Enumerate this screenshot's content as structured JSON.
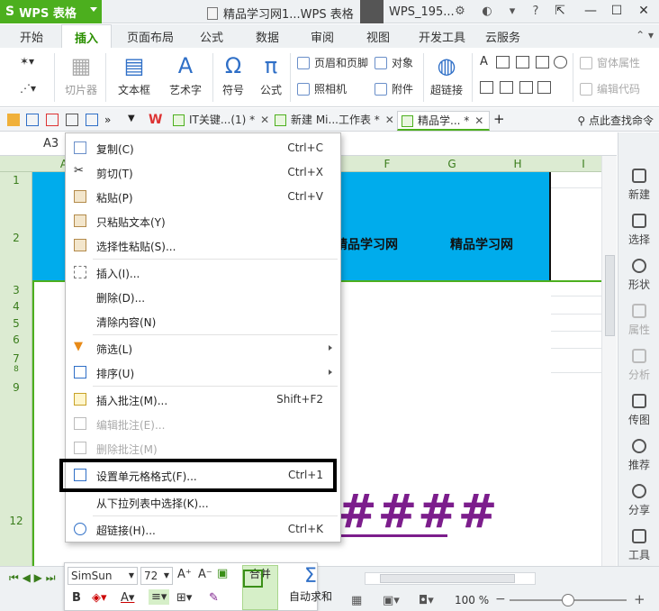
{
  "app": {
    "name": "WPS 表格",
    "logo": "S"
  },
  "title": {
    "doc": "精品学习网1...WPS 表格",
    "user": "WPS_195..."
  },
  "menu_tabs": [
    "开始",
    "插入",
    "页面布局",
    "公式",
    "数据",
    "审阅",
    "视图",
    "开发工具",
    "云服务"
  ],
  "ribbon": {
    "clipboard": "切片器",
    "textbox": "文本框",
    "wordart": "艺术字",
    "symbol": "符号",
    "formula": "公式",
    "header_footer": "页眉和页脚",
    "object": "对象",
    "camera": "照相机",
    "attachment": "附件",
    "hyperlink": "超链接",
    "window_props": "窗体属性",
    "edit_code": "编辑代码"
  },
  "doc_tabs": [
    {
      "label": "IT关键...(1) *"
    },
    {
      "label": "新建 Mi...工作表 *"
    },
    {
      "label": "精品学... *"
    }
  ],
  "find_command": "点此查找命令",
  "cell_ref": "A3",
  "columns": [
    "A",
    "F",
    "G",
    "H",
    "I"
  ],
  "rows": [
    "1",
    "2",
    "3",
    "4",
    "5",
    "6",
    "7",
    "8",
    "9",
    "12"
  ],
  "band_texts": [
    "精品学习网",
    "精品学习网"
  ],
  "hash_text": "####",
  "context_menu": [
    {
      "label": "复制(C)",
      "shortcut": "Ctrl+C",
      "icon": "copy-icon"
    },
    {
      "label": "剪切(T)",
      "shortcut": "Ctrl+X",
      "icon": "cut-icon"
    },
    {
      "label": "粘贴(P)",
      "shortcut": "Ctrl+V",
      "icon": "paste-icon"
    },
    {
      "label": "只粘贴文本(Y)",
      "shortcut": "",
      "icon": "paste-text-icon"
    },
    {
      "label": "选择性粘贴(S)...",
      "shortcut": "",
      "icon": "paste-special-icon"
    },
    {
      "label": "插入(I)...",
      "shortcut": "",
      "icon": "insert-icon"
    },
    {
      "label": "删除(D)...",
      "shortcut": "",
      "icon": ""
    },
    {
      "label": "清除内容(N)",
      "shortcut": "",
      "icon": ""
    },
    {
      "label": "筛选(L)",
      "shortcut": "",
      "icon": "filter-icon"
    },
    {
      "label": "排序(U)",
      "shortcut": "",
      "icon": "sort-icon"
    },
    {
      "label": "插入批注(M)...",
      "shortcut": "Shift+F2",
      "icon": "comment-icon"
    },
    {
      "label": "编辑批注(E)...",
      "shortcut": "",
      "icon": "edit-comment-icon"
    },
    {
      "label": "删除批注(M)",
      "shortcut": "",
      "icon": "delete-comment-icon"
    },
    {
      "label": "设置单元格格式(F)...",
      "shortcut": "Ctrl+1",
      "icon": "format-cells-icon"
    },
    {
      "label": "从下拉列表中选择(K)...",
      "shortcut": "",
      "icon": ""
    },
    {
      "label": "超链接(H)...",
      "shortcut": "Ctrl+K",
      "icon": "hyperlink-icon"
    }
  ],
  "right_panel": [
    "新建",
    "选择",
    "形状",
    "属性",
    "分析",
    "传图",
    "推荐",
    "分享",
    "工具"
  ],
  "format_bar": {
    "font": "SimSun",
    "size": "72",
    "merge": "合并",
    "autosum": "自动求和"
  },
  "status": {
    "zoom": "100 %",
    "zoom_level": 0.5
  },
  "colors": {
    "accent": "#4caf1e",
    "band": "#00acec",
    "hash": "#7c1d8c"
  }
}
